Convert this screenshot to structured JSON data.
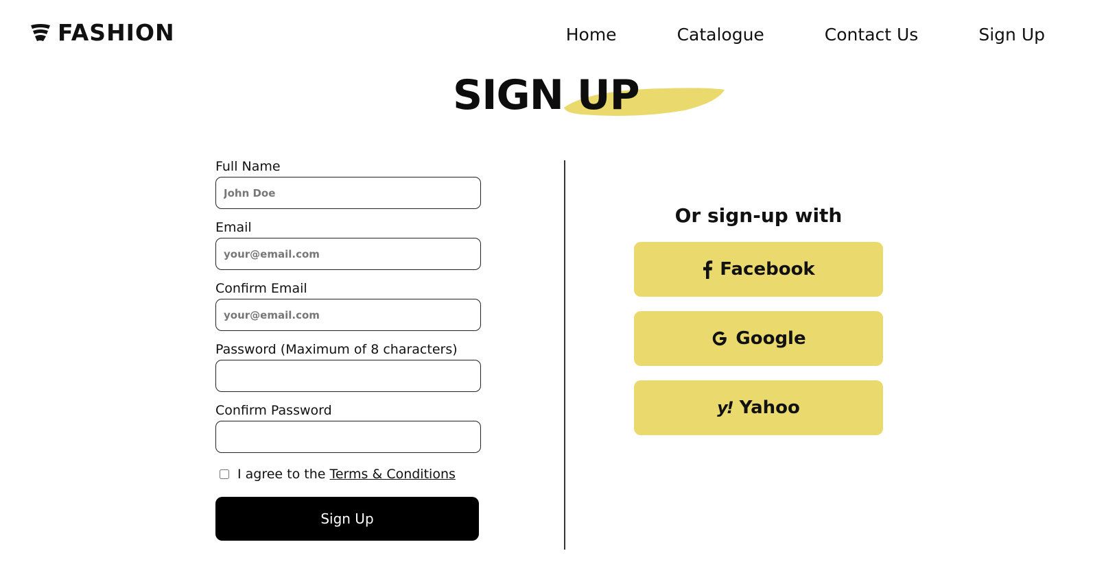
{
  "header": {
    "brand": "FASHION",
    "nav": [
      {
        "label": "Home"
      },
      {
        "label": "Catalogue"
      },
      {
        "label": "Contact Us"
      },
      {
        "label": "Sign Up"
      }
    ]
  },
  "title": "SIGN UP",
  "form": {
    "fields": [
      {
        "label": "Full Name",
        "placeholder": "John Doe",
        "value": ""
      },
      {
        "label": "Email",
        "placeholder": "your@email.com",
        "value": ""
      },
      {
        "label": "Confirm Email",
        "placeholder": "your@email.com",
        "value": ""
      },
      {
        "label": "Password (Maximum of 8 characters)",
        "placeholder": "",
        "value": ""
      },
      {
        "label": "Confirm Password",
        "placeholder": "",
        "value": ""
      }
    ],
    "agree_text": "I agree to the",
    "terms_link": "Terms & Conditions",
    "agree_checked": false,
    "submit_label": "Sign Up"
  },
  "social": {
    "heading": "Or sign-up with",
    "buttons": [
      {
        "label": "Facebook",
        "icon": "facebook-icon"
      },
      {
        "label": "Google",
        "icon": "google-icon"
      },
      {
        "label": "Yahoo",
        "icon": "yahoo-icon",
        "icon_text": "y!"
      }
    ],
    "accent_color": "#ead96c"
  }
}
